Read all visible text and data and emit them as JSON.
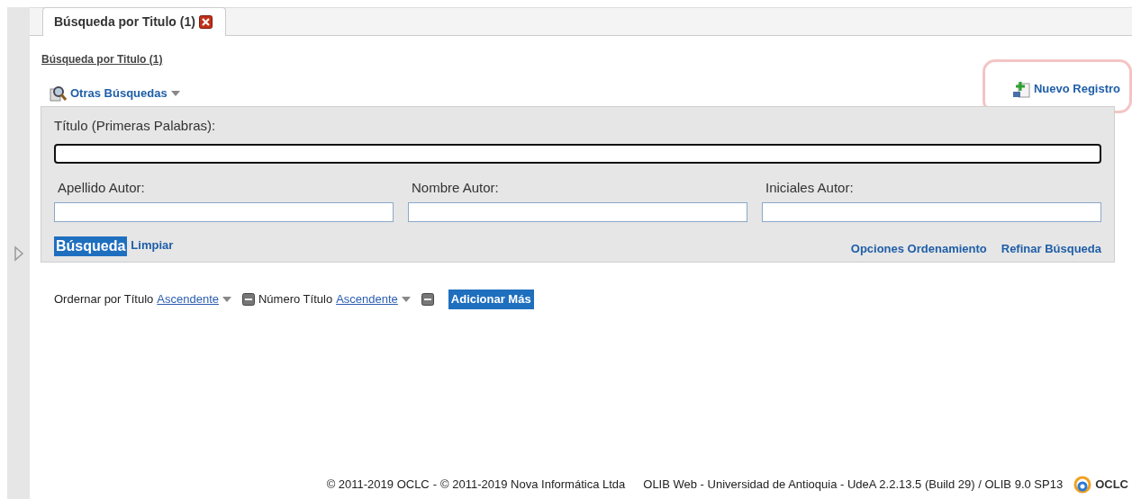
{
  "tabs": [
    {
      "label": "Búsqueda por Titulo (1)",
      "selected": true
    }
  ],
  "breadcrumb": "Búsqueda por Titulo (1)",
  "toolbar": {
    "other_searches": "Otras Búsquedas",
    "new_record": "Nuevo Registro",
    "new_record_highlighted": true
  },
  "form": {
    "title_label": "Título (Primeras Palabras):",
    "fields": [
      {
        "label": "Apellido Autor:"
      },
      {
        "label": "Nombre Autor:"
      },
      {
        "label": "Iniciales Autor:"
      }
    ],
    "search_button": "Búsqueda",
    "clear_link": "Limpiar",
    "sort_options_link": "Opciones Ordenamiento",
    "refine_link": "Refinar Búsqueda"
  },
  "sort": {
    "prefix": "Ordernar por",
    "items": [
      {
        "field": "Título",
        "order": "Ascendente"
      },
      {
        "field": "Número Título",
        "order": "Ascendente"
      }
    ],
    "add_more": "Adicionar Más"
  },
  "footer": {
    "links": [
      "© 2011-2019 OCLC",
      "© 2011-2019 Nova Informática Ltda"
    ],
    "separator": "-",
    "info": "OLIB Web - Universidad de Antioquia - UdeA  2.2.13.5  (Build 29)  /  OLIB 9.0 SP13",
    "logo_text": "OCLC"
  }
}
